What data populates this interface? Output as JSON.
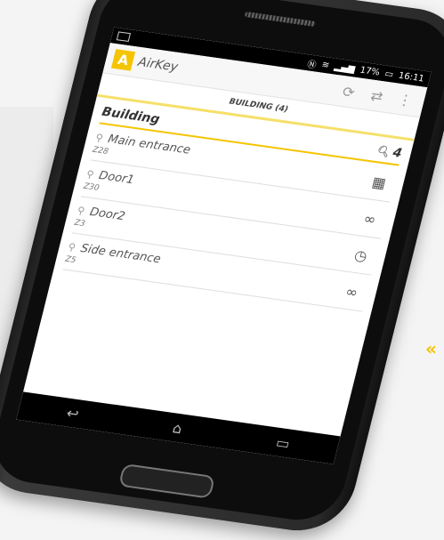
{
  "status": {
    "icons_left": [
      "image-icon"
    ],
    "battery": "17%",
    "time": "16:11"
  },
  "app": {
    "logo_letter": "A",
    "title": "AirKey",
    "actions": [
      "sync-icon",
      "swap-icon",
      "more-icon"
    ]
  },
  "tab": {
    "label": "BUILDING (4)"
  },
  "section": {
    "title": "Building",
    "count": "4"
  },
  "items": [
    {
      "name": "Main entrance",
      "code": "Z28",
      "status_icon": "calendar-icon"
    },
    {
      "name": "Door1",
      "code": "Z30",
      "status_icon": "infinity-icon"
    },
    {
      "name": "Door2",
      "code": "Z3",
      "status_icon": "clock-icon"
    },
    {
      "name": "Side entrance",
      "code": "Z5",
      "status_icon": "infinity-icon"
    }
  ],
  "nav": [
    "back-icon",
    "home-icon",
    "recents-icon"
  ],
  "colors": {
    "accent": "#f5c400",
    "accent_light": "#f5e06a"
  }
}
